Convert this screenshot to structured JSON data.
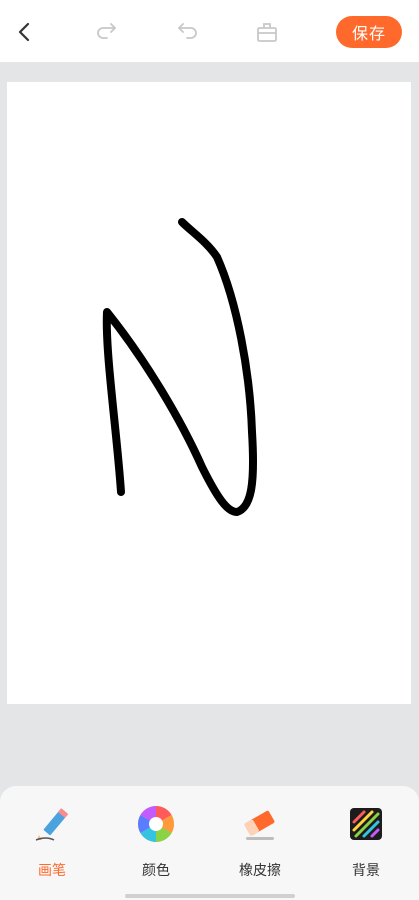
{
  "header": {
    "save_label": "保存"
  },
  "icons": {
    "back": "chevron-left-icon",
    "redo": "redo-icon",
    "undo": "undo-icon",
    "clear": "trash-icon"
  },
  "colors": {
    "accent": "#ff6a2c",
    "stroke": "#000000",
    "canvas": "#ffffff",
    "background": "#e4e5e7",
    "toolbar": "#f7f7f8"
  },
  "toolbar": {
    "tools": [
      {
        "label": "画笔",
        "icon": "pencil-icon",
        "active": true
      },
      {
        "label": "颜色",
        "icon": "color-wheel-icon",
        "active": false
      },
      {
        "label": "橡皮擦",
        "icon": "eraser-icon",
        "active": false
      },
      {
        "label": "背景",
        "icon": "background-icon",
        "active": false
      }
    ]
  }
}
